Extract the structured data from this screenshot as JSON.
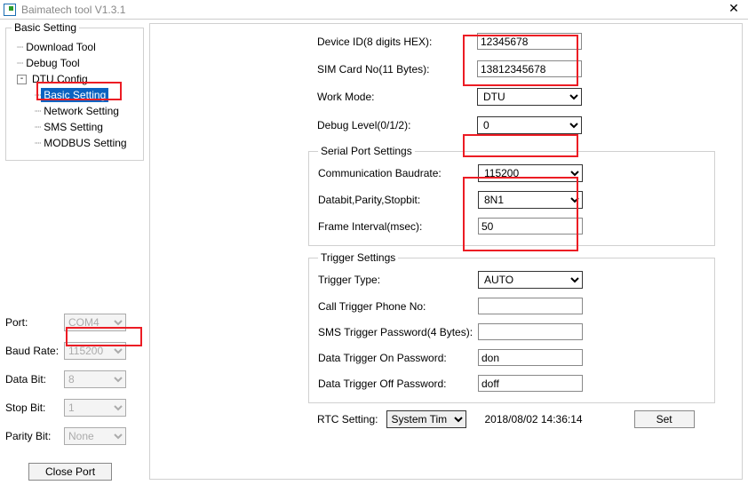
{
  "window": {
    "title": "Baimatech tool V1.3.1"
  },
  "sidebar": {
    "legend": "Basic Setting",
    "tree": {
      "download_tool": "Download Tool",
      "debug_tool": "Debug Tool",
      "dtu_config": "DTU Config",
      "basic_setting": "Basic Setting",
      "network_setting": "Network Setting",
      "sms_setting": "SMS Setting",
      "modbus_setting": "MODBUS Setting"
    },
    "port_label": "Port:",
    "port_value": "COM4",
    "baud_label": "Baud Rate:",
    "baud_value": "115200",
    "databit_label": "Data Bit:",
    "databit_value": "8",
    "stopbit_label": "Stop Bit:",
    "stopbit_value": "1",
    "parity_label": "Parity Bit:",
    "parity_value": "None",
    "close_port": "Close Port"
  },
  "main": {
    "device_id_label": "Device ID(8 digits HEX):",
    "device_id_value": "12345678",
    "sim_label": "SIM Card No(11 Bytes):",
    "sim_value": "13812345678",
    "workmode_label": "Work Mode:",
    "workmode_value": "DTU",
    "debug_label": "Debug Level(0/1/2):",
    "debug_value": "0",
    "serial_legend": "Serial Port Settings",
    "baudrate_label": "Communication Baudrate:",
    "baudrate_value": "115200",
    "dps_label": "Databit,Parity,Stopbit:",
    "dps_value": "8N1",
    "frame_label": "Frame Interval(msec):",
    "frame_value": "50",
    "trigger_legend": "Trigger Settings",
    "trigger_type_label": "Trigger Type:",
    "trigger_type_value": "AUTO",
    "call_trigger_label": "Call Trigger Phone No:",
    "call_trigger_value": "",
    "sms_pw_label": "SMS Trigger Password(4 Bytes):",
    "sms_pw_value": "",
    "data_on_label": "Data Trigger On Password:",
    "data_on_value": "don",
    "data_off_label": "Data Trigger Off Password:",
    "data_off_value": "doff",
    "rtc_label": "RTC Setting:",
    "rtc_value": "System Tim",
    "rtc_timestamp": "2018/08/02 14:36:14",
    "set_button": "Set"
  }
}
